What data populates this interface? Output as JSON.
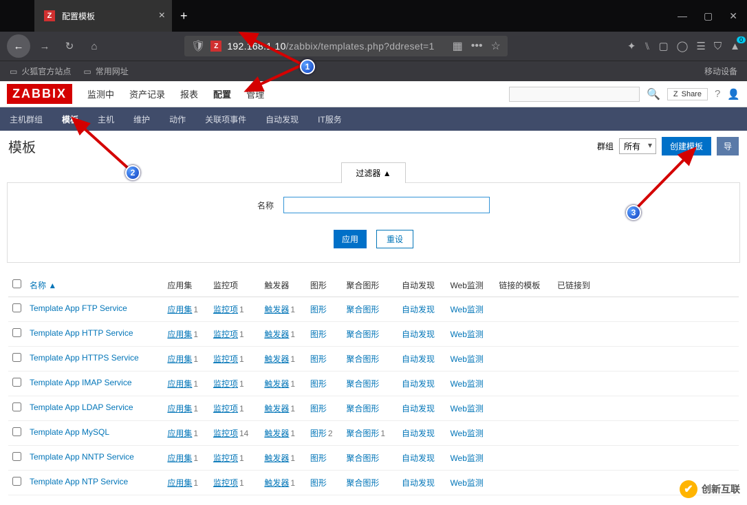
{
  "browser": {
    "tab_title": "配置模板",
    "url_host": "192.168.1.10",
    "url_path": "/zabbix/templates.php?ddreset=1",
    "bm1": "火狐官方站点",
    "bm2": "常用网址",
    "bm_right": "移动设备"
  },
  "zabbix": {
    "logo": "ZABBIX",
    "nav": {
      "n1": "监测中",
      "n2": "资产记录",
      "n3": "报表",
      "n4": "配置",
      "n5": "管理"
    },
    "share": "Share",
    "sub": {
      "s1": "主机群组",
      "s2": "模板",
      "s3": "主机",
      "s4": "维护",
      "s5": "动作",
      "s6": "关联项事件",
      "s7": "自动发现",
      "s8": "IT服务"
    },
    "page_title": "模板",
    "group_label": "群组",
    "group_value": "所有",
    "btn_create": "创建模板",
    "btn_import": "导",
    "filter_tab": "过滤器 ▲",
    "filter_label": "名称",
    "btn_apply": "应用",
    "btn_reset": "重设",
    "cols": {
      "c_name": "名称",
      "c_app": "应用集",
      "c_item": "监控项",
      "c_trig": "触发器",
      "c_graph": "图形",
      "c_agraph": "聚合图形",
      "c_disc": "自动发现",
      "c_web": "Web监测",
      "c_linked": "链接的模板",
      "c_linkedto": "已链接到"
    },
    "sort_icon": "▲",
    "cell": {
      "app": "应用集",
      "item": "监控项",
      "trig": "触发器",
      "graph": "图形",
      "agraph": "聚合图形",
      "disc": "自动发现",
      "web": "Web监测"
    },
    "rows": [
      {
        "name": "Template App FTP Service",
        "app": "1",
        "item": "1",
        "trig": "1",
        "graph": "",
        "agraph": "",
        "disc": "",
        "web": ""
      },
      {
        "name": "Template App HTTP Service",
        "app": "1",
        "item": "1",
        "trig": "1",
        "graph": "",
        "agraph": "",
        "disc": "",
        "web": ""
      },
      {
        "name": "Template App HTTPS Service",
        "app": "1",
        "item": "1",
        "trig": "1",
        "graph": "",
        "agraph": "",
        "disc": "",
        "web": ""
      },
      {
        "name": "Template App IMAP Service",
        "app": "1",
        "item": "1",
        "trig": "1",
        "graph": "",
        "agraph": "",
        "disc": "",
        "web": ""
      },
      {
        "name": "Template App LDAP Service",
        "app": "1",
        "item": "1",
        "trig": "1",
        "graph": "",
        "agraph": "",
        "disc": "",
        "web": ""
      },
      {
        "name": "Template App MySQL",
        "app": "1",
        "item": "14",
        "trig": "1",
        "graph": "2",
        "agraph": "1",
        "disc": "",
        "web": ""
      },
      {
        "name": "Template App NNTP Service",
        "app": "1",
        "item": "1",
        "trig": "1",
        "graph": "",
        "agraph": "",
        "disc": "",
        "web": ""
      },
      {
        "name": "Template App NTP Service",
        "app": "1",
        "item": "1",
        "trig": "1",
        "graph": "",
        "agraph": "",
        "disc": "",
        "web": ""
      }
    ]
  },
  "annot": {
    "n1": "1",
    "n2": "2",
    "n3": "3"
  },
  "watermark": "创新互联"
}
